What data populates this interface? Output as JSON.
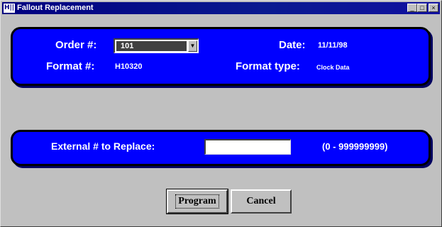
{
  "window": {
    "icon_text": "H||",
    "title": "Fallout Replacement",
    "minimize_glyph": "_",
    "maximize_glyph": "□",
    "close_glyph": "×"
  },
  "order_panel": {
    "order_label": "Order #:",
    "order_value": "101",
    "dropdown_arrow": "▼",
    "date_label": "Date:",
    "date_value": "11/11/98",
    "format_label": "Format #:",
    "format_value": "H10320",
    "format_type_label": "Format type:",
    "format_type_value": "Clock Data"
  },
  "replace_panel": {
    "external_label": "External # to Replace:",
    "external_value": "",
    "range_text": "(0 - 999999999)"
  },
  "buttons": {
    "program_label": "Program",
    "cancel_label": "Cancel"
  },
  "colors": {
    "panel_blue": "#0000ff",
    "title_bar": "#000080",
    "window_gray": "#c0c0c0"
  }
}
